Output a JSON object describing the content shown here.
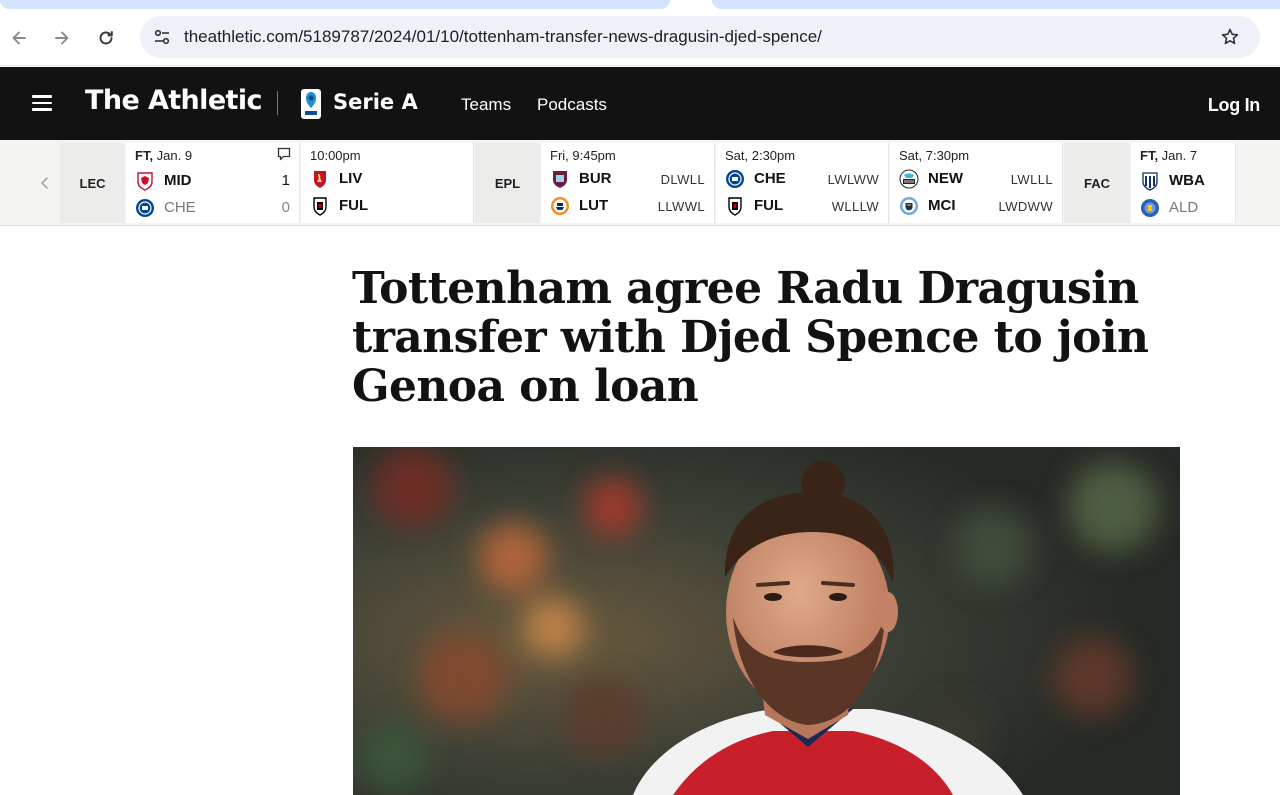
{
  "browser": {
    "url": "theathletic.com/5189787/2024/01/10/tottenham-transfer-news-dragusin-djed-spence/",
    "back_icon": "arrow-left-icon",
    "forward_icon": "arrow-right-icon",
    "reload_icon": "reload-icon",
    "site_info_icon": "tune-icon",
    "bookmark_icon": "star-icon"
  },
  "header": {
    "logo": "The Athletic",
    "league": "Serie A",
    "nav": [
      "Teams",
      "Podcasts"
    ],
    "login": "Log In",
    "colors": {
      "background": "#121212",
      "text": "#ffffff"
    }
  },
  "scores": {
    "groups": [
      {
        "league": "LEC",
        "games": [
          {
            "time_bold": "FT,",
            "time": " Jan. 9",
            "comment_icon": "comment-icon",
            "teams": [
              {
                "abbr": "MID",
                "score": "1",
                "crest": "middlesbrough-crest"
              },
              {
                "abbr": "CHE",
                "score": "0",
                "crest": "chelsea-crest",
                "loser": true
              }
            ]
          },
          {
            "time_bold": "",
            "time": "10:00pm",
            "teams": [
              {
                "abbr": "LIV",
                "crest": "liverpool-crest"
              },
              {
                "abbr": "FUL",
                "crest": "fulham-crest"
              }
            ]
          }
        ]
      },
      {
        "league": "EPL",
        "games": [
          {
            "time_bold": "",
            "time": "Fri, 9:45pm",
            "teams": [
              {
                "abbr": "BUR",
                "form": "DLWLL",
                "crest": "burnley-crest"
              },
              {
                "abbr": "LUT",
                "form": "LLWWL",
                "crest": "luton-crest"
              }
            ]
          },
          {
            "time_bold": "",
            "time": "Sat, 2:30pm",
            "teams": [
              {
                "abbr": "CHE",
                "form": "LWLWW",
                "crest": "chelsea-crest"
              },
              {
                "abbr": "FUL",
                "form": "WLLLW",
                "crest": "fulham-crest"
              }
            ]
          },
          {
            "time_bold": "",
            "time": "Sat, 7:30pm",
            "teams": [
              {
                "abbr": "NEW",
                "form": "LWLLL",
                "crest": "newcastle-crest"
              },
              {
                "abbr": "MCI",
                "form": "LWDWW",
                "crest": "man-city-crest"
              }
            ]
          }
        ]
      },
      {
        "league": "FAC",
        "games": [
          {
            "time_bold": "FT,",
            "time": " Jan. 7",
            "teams": [
              {
                "abbr": "WBA",
                "crest": "west-brom-crest"
              },
              {
                "abbr": "ALD",
                "crest": "aldershot-crest",
                "loser": true
              }
            ]
          }
        ]
      }
    ]
  },
  "article": {
    "headline": "Tottenham agree Radu Dragusin transfer with Djed Spence to join Genoa on loan"
  }
}
